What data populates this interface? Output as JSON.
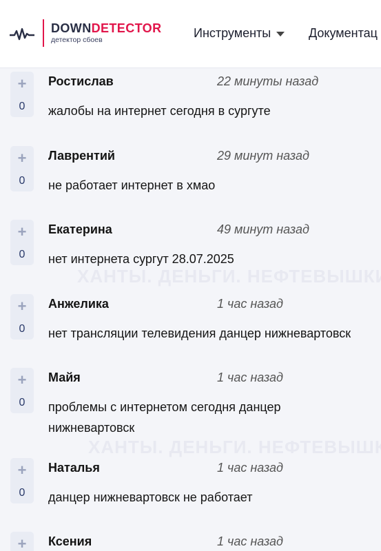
{
  "header": {
    "logo": {
      "name_part1": "DOWN",
      "name_part2": "DETECTOR",
      "tagline": "детектор сбоев"
    },
    "nav": {
      "tools_label": "Инструменты",
      "docs_label": "Документац"
    }
  },
  "comments": [
    {
      "author": "Ростислав",
      "time": "22 минуты назад",
      "text": "жалобы на интернет сегодня в сургуте",
      "votes": "0"
    },
    {
      "author": "Лаврентий",
      "time": "29 минут назад",
      "text": "не работает интернет в хмао",
      "votes": "0"
    },
    {
      "author": "Екатерина",
      "time": "49 минут назад",
      "text": "нет интернета сургут 28.07.2025",
      "votes": "0"
    },
    {
      "author": "Анжелика",
      "time": "1 час назад",
      "text": "нет трансляции телевидения данцер нижневартовск",
      "votes": "0"
    },
    {
      "author": "Майя",
      "time": "1 час назад",
      "text": "проблемы с интернетом сегодня данцер нижневартовск",
      "votes": "0"
    },
    {
      "author": "Наталья",
      "time": "1 час назад",
      "text": "данцер нижневартовск не работает",
      "votes": "0"
    },
    {
      "author": "Ксения",
      "time": "1 час назад",
      "text": "",
      "votes": ""
    }
  ],
  "watermark": {
    "text": "ХАНТЫ. ДЕНЬГИ. НЕФТЕВЫШКИ"
  },
  "colors": {
    "accent": "#e1154a",
    "logo_dark": "#2a2f45",
    "vote_box": "#e9ecf4",
    "background": "#f4f5f9"
  },
  "icons": {
    "logo": "pulse-icon",
    "nav_tools": "caret-down-icon",
    "vote": "plus-icon"
  }
}
